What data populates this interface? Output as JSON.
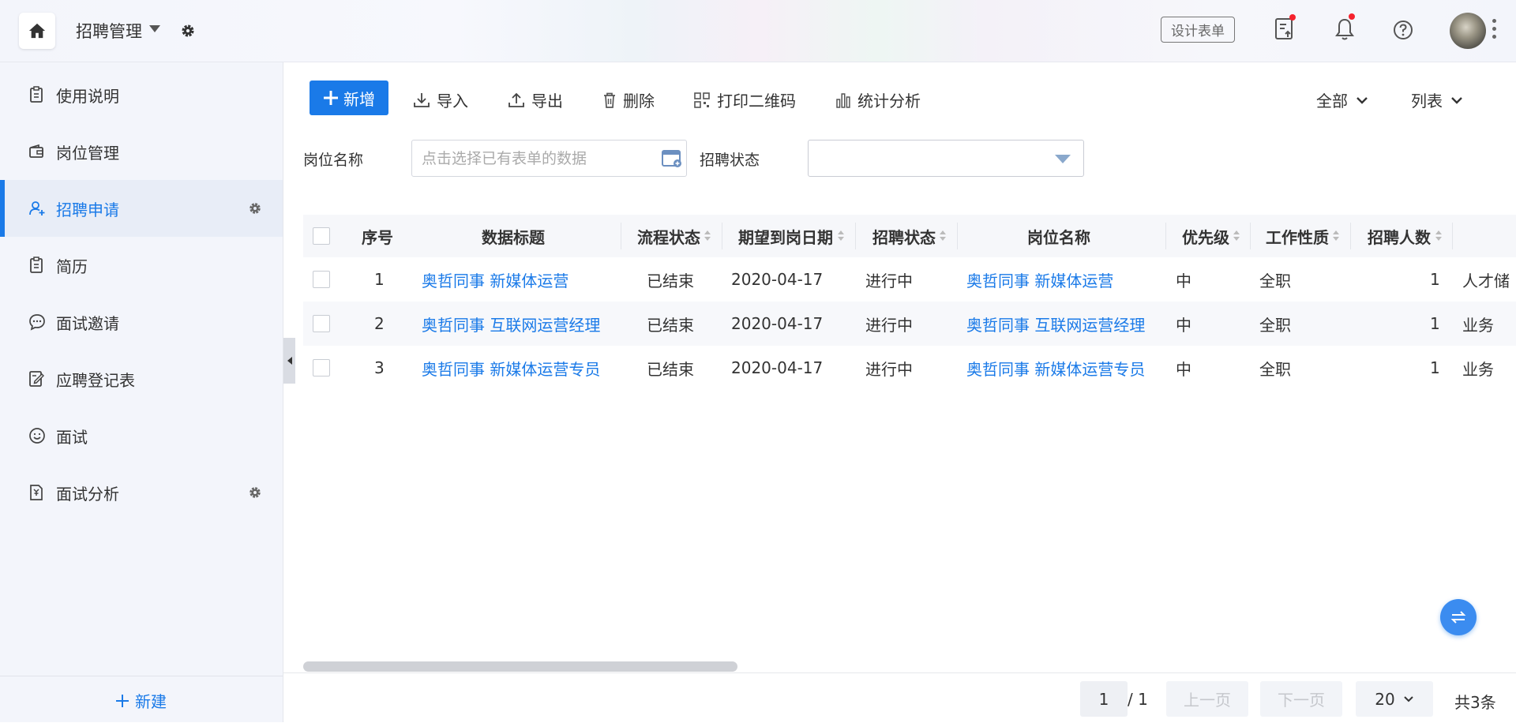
{
  "header": {
    "app_title": "招聘管理",
    "design_button": "设计表单",
    "colors": {
      "accent": "#1a7ae8",
      "badge": "#f5222d"
    }
  },
  "sidebar": {
    "items": [
      {
        "label": "使用说明",
        "icon": "clipboard-icon"
      },
      {
        "label": "岗位管理",
        "icon": "wallet-icon"
      },
      {
        "label": "招聘申请",
        "icon": "user-plus-icon",
        "active": true
      },
      {
        "label": "简历",
        "icon": "clipboard-icon"
      },
      {
        "label": "面试邀请",
        "icon": "chat-bubble-icon"
      },
      {
        "label": "应聘登记表",
        "icon": "edit-form-icon"
      },
      {
        "label": "面试",
        "icon": "smile-icon"
      },
      {
        "label": "面试分析",
        "icon": "report-icon"
      }
    ],
    "new_label": "新建"
  },
  "toolbar": {
    "add": "新增",
    "import": "导入",
    "export": "导出",
    "delete": "删除",
    "print_qr": "打印二维码",
    "stats": "统计分析",
    "filter_all": "全部",
    "view_mode": "列表"
  },
  "filters": {
    "position_label": "岗位名称",
    "position_placeholder": "点击选择已有表单的数据",
    "position_value": "",
    "status_label": "招聘状态",
    "status_value": ""
  },
  "table": {
    "columns": [
      "序号",
      "数据标题",
      "流程状态",
      "期望到岗日期",
      "招聘状态",
      "岗位名称",
      "优先级",
      "工作性质",
      "招聘人数"
    ],
    "rows": [
      {
        "index": "1",
        "title": "奥哲同事 新媒体运营",
        "flow": "已结束",
        "date": "2020-04-17",
        "status": "进行中",
        "position": "奥哲同事 新媒体运营",
        "priority": "中",
        "nature": "全职",
        "count": "1",
        "extra": "人才储"
      },
      {
        "index": "2",
        "title": "奥哲同事 互联网运营经理",
        "flow": "已结束",
        "date": "2020-04-17",
        "status": "进行中",
        "position": "奥哲同事 互联网运营经理",
        "priority": "中",
        "nature": "全职",
        "count": "1",
        "extra": "业务"
      },
      {
        "index": "3",
        "title": "奥哲同事 新媒体运营专员",
        "flow": "已结束",
        "date": "2020-04-17",
        "status": "进行中",
        "position": "奥哲同事 新媒体运营专员",
        "priority": "中",
        "nature": "全职",
        "count": "1",
        "extra": "业务"
      }
    ]
  },
  "pagination": {
    "current": "1",
    "total_pages": "/ 1",
    "prev": "上一页",
    "next": "下一页",
    "page_size": "20",
    "total_count": "共3条"
  }
}
